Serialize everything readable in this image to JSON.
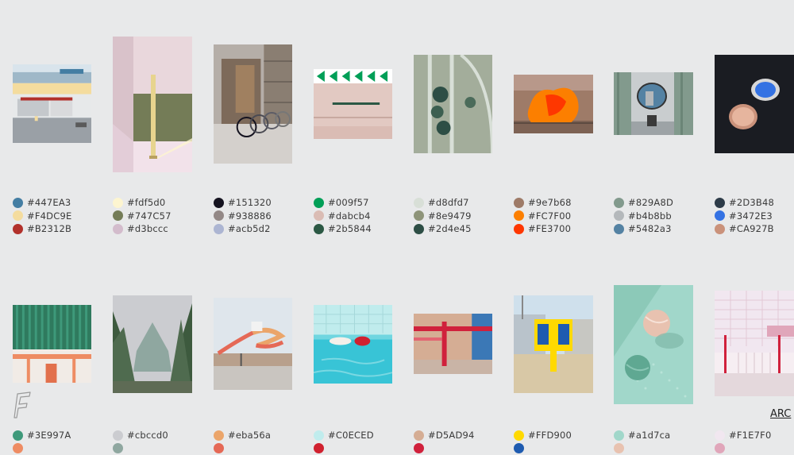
{
  "brand": {
    "logo_icon": "f-letter-logo-icon"
  },
  "nav": {
    "archive_link": "ARC"
  },
  "rows": [
    {
      "cards": [
        {
          "photo": "building-facade-photo",
          "colors": [
            {
              "hex": "#447EA3",
              "label": "#447EA3"
            },
            {
              "hex": "#F4DC9E",
              "label": "#F4DC9E"
            },
            {
              "hex": "#B2312B",
              "label": "#B2312B"
            }
          ]
        },
        {
          "photo": "pink-room-pole-photo",
          "colors": [
            {
              "hex": "#fdf5d0",
              "label": "#fdf5d0"
            },
            {
              "hex": "#747C57",
              "label": "#747C57"
            },
            {
              "hex": "#d3bccc",
              "label": "#d3bccc"
            }
          ]
        },
        {
          "photo": "bicycle-rack-photo",
          "colors": [
            {
              "hex": "#151320",
              "label": "#151320"
            },
            {
              "hex": "#938886",
              "label": "#938886"
            },
            {
              "hex": "#acb5d2",
              "label": "#acb5d2"
            }
          ]
        },
        {
          "photo": "green-arrows-wall-photo",
          "colors": [
            {
              "hex": "#009f57",
              "label": "#009f57"
            },
            {
              "hex": "#dabcb4",
              "label": "#dabcb4"
            },
            {
              "hex": "#2b5844",
              "label": "#2b5844"
            }
          ]
        },
        {
          "photo": "greenhouse-photo",
          "colors": [
            {
              "hex": "#d8dfd7",
              "label": "#d8dfd7"
            },
            {
              "hex": "#8e9479",
              "label": "#8e9479"
            },
            {
              "hex": "#2d4e45",
              "label": "#2d4e45"
            }
          ]
        },
        {
          "photo": "orange-tarp-photo",
          "colors": [
            {
              "hex": "#9e7b68",
              "label": "#9e7b68"
            },
            {
              "hex": "#FC7F00",
              "label": "#FC7F00"
            },
            {
              "hex": "#FE3700",
              "label": "#FE3700"
            }
          ]
        },
        {
          "photo": "round-window-room-photo",
          "colors": [
            {
              "hex": "#829A8D",
              "label": "#829A8D"
            },
            {
              "hex": "#b4b8bb",
              "label": "#b4b8bb"
            },
            {
              "hex": "#5482a3",
              "label": "#5482a3"
            }
          ]
        },
        {
          "photo": "skylight-dark-photo",
          "colors": [
            {
              "hex": "#2D3B48",
              "label": "#2D3B48"
            },
            {
              "hex": "#3472E3",
              "label": "#3472E3"
            },
            {
              "hex": "#CA927B",
              "label": "#CA927B"
            }
          ]
        }
      ]
    },
    {
      "cards": [
        {
          "photo": "green-shutter-photo",
          "colors": [
            {
              "hex": "#3E997A",
              "label": "#3E997A"
            },
            {
              "hex": "#EE8C63",
              "label": ""
            }
          ]
        },
        {
          "photo": "covered-tree-photo",
          "colors": [
            {
              "hex": "#cbccd0",
              "label": "#cbccd0"
            },
            {
              "hex": "#8FA7A0",
              "label": ""
            }
          ]
        },
        {
          "photo": "water-slide-photo",
          "colors": [
            {
              "hex": "#eba56a",
              "label": "#eba56a"
            },
            {
              "hex": "#E56956",
              "label": ""
            }
          ]
        },
        {
          "photo": "swimming-pool-photo",
          "colors": [
            {
              "hex": "#C0ECED",
              "label": "#C0ECED"
            },
            {
              "hex": "#D0212F",
              "label": ""
            }
          ]
        },
        {
          "photo": "red-pipe-wall-photo",
          "colors": [
            {
              "hex": "#D5AD94",
              "label": "#D5AD94"
            },
            {
              "hex": "#D0213C",
              "label": ""
            }
          ]
        },
        {
          "photo": "yellow-phone-booth-photo",
          "colors": [
            {
              "hex": "#FFD900",
              "label": "#FFD900"
            },
            {
              "hex": "#1E5BB0",
              "label": ""
            }
          ]
        },
        {
          "photo": "tennis-balls-photo",
          "colors": [
            {
              "hex": "#a1d7ca",
              "label": "#a1d7ca"
            },
            {
              "hex": "#E8C2B0",
              "label": ""
            }
          ]
        },
        {
          "photo": "pink-building-photo",
          "colors": [
            {
              "hex": "#F1E7F0",
              "label": "#F1E7F0"
            },
            {
              "hex": "#E0A6BA",
              "label": ""
            }
          ]
        }
      ]
    }
  ]
}
